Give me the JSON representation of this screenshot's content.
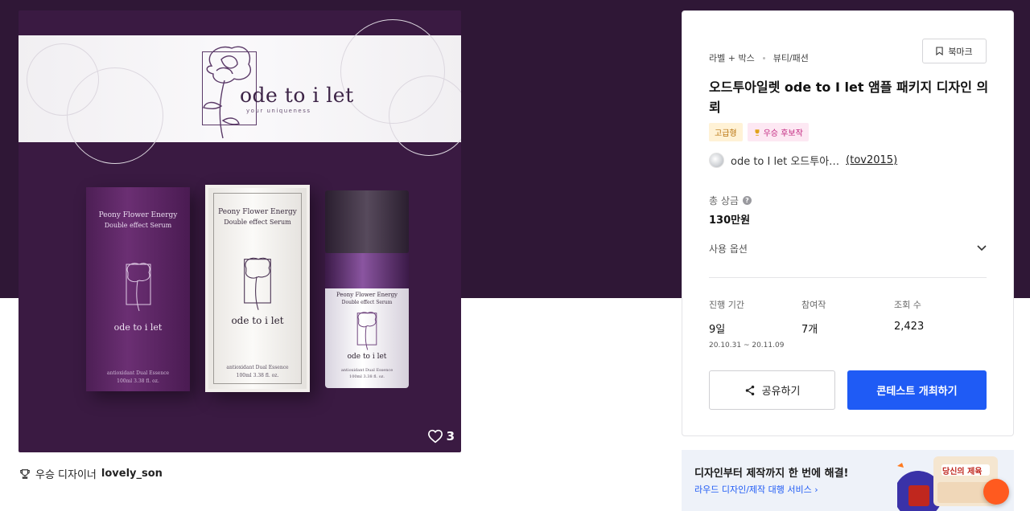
{
  "gallery": {
    "brand": "ode to i let",
    "tagline": "your uniqueness",
    "product_name_line1": "Peony Flower Energy",
    "product_name_line2": "Double effect Serum",
    "box_brand": "ode to i let",
    "box_dark_desc": "antioxidant Dual Essence",
    "box_dark_volume": "100ml 3.38 fl. oz.",
    "box_white_desc": "antioxidant Dual Essence",
    "box_white_volume": "100ml 3.38 fl. oz.",
    "bottle_name_line1": "Peony Flower Energy",
    "bottle_name_line2": "Double effect Serum",
    "bottle_brand": "ode to i let",
    "bottle_desc": "antioxidant Dual Essence",
    "bottle_volume": "100ml 3.38 fl. oz.",
    "like_count": "3",
    "icons": {
      "like": "heart-icon",
      "winner": "trophy-icon"
    }
  },
  "winner": {
    "label": "우승 디자이너",
    "designer": "lovely_son"
  },
  "contest": {
    "category_main": "라벨 + 박스",
    "category_sub": "뷰티/패션",
    "bookmark_label": "북마크",
    "title": "오드투아일렛 ode to I let 앰플 패키지 디자인 의뢰",
    "badge_grade": "고급형",
    "badge_winner_candidate": "우승 후보작",
    "client_name": "ode to I let 오드투아…",
    "client_handle": "(tov2015)",
    "prize_label": "총 상금",
    "prize_value": "130만원",
    "usage_label": "사용 옵션",
    "stats": [
      {
        "label": "진행 기간",
        "value": "9일",
        "sub": "20.10.31 ~ 20.11.09"
      },
      {
        "label": "참여작",
        "value": "7개",
        "sub": ""
      },
      {
        "label": "조회 수",
        "value": "2,423",
        "sub": ""
      }
    ],
    "share_label": "공유하기",
    "host_label": "콘테스트 개최하기"
  },
  "ad": {
    "headline": "디자인부터 제작까지 한 번에 해결!",
    "link": "라우드 디자인/제작 대행 서비스",
    "promo_text": "당신의 제육"
  },
  "colors": {
    "hero_bg": "#2f1736",
    "primary": "#1f5bf5",
    "fab": "#ff5a1f",
    "badge_premium": "#b7710b",
    "badge_candidate": "#c2267f"
  }
}
